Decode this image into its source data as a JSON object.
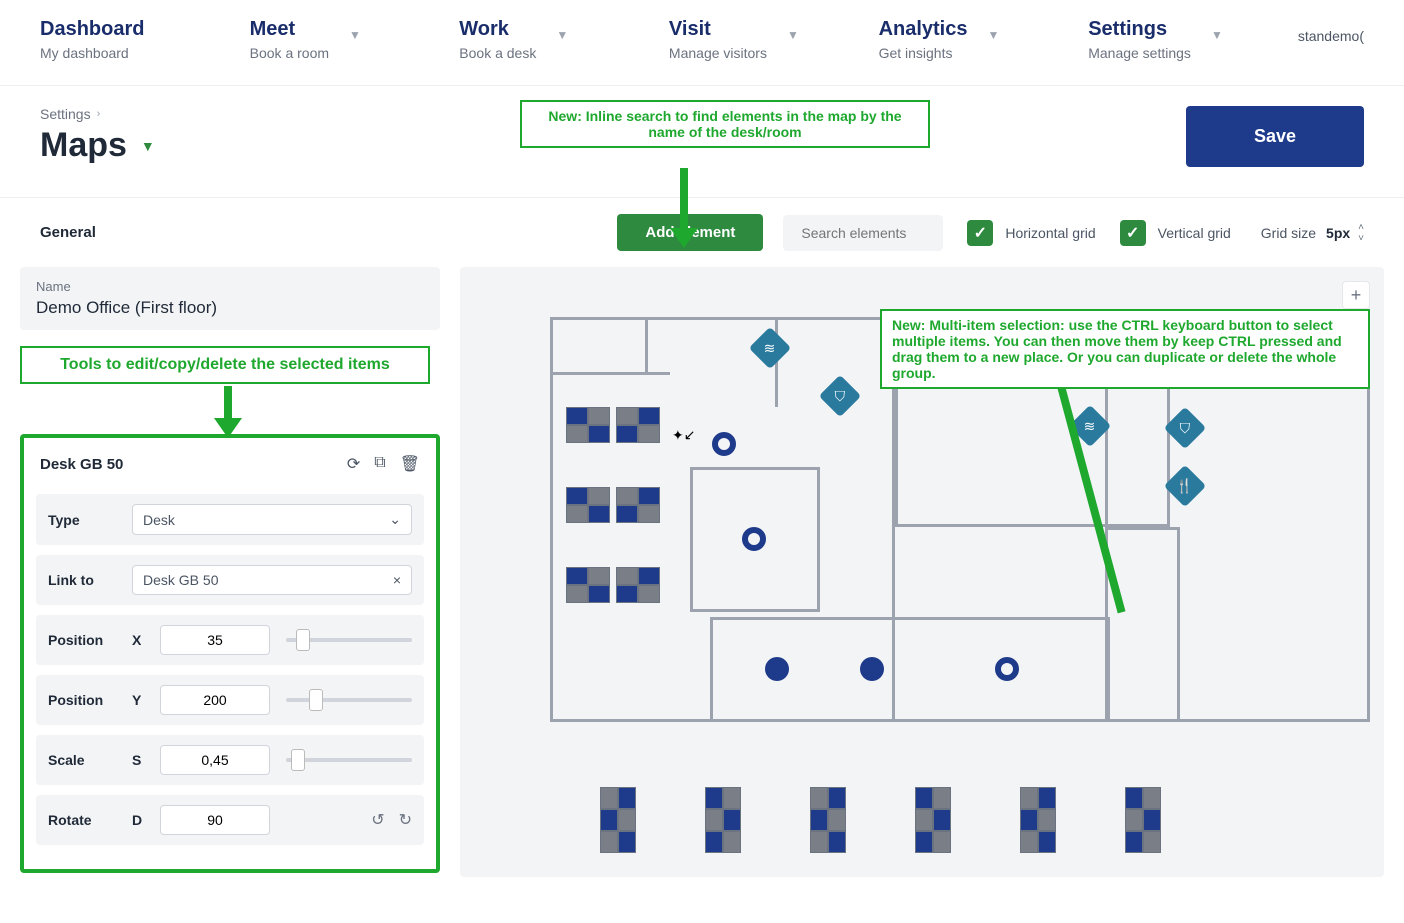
{
  "nav": {
    "items": [
      {
        "title": "Dashboard",
        "sub": "My dashboard",
        "chev": false
      },
      {
        "title": "Meet",
        "sub": "Book a room",
        "chev": true
      },
      {
        "title": "Work",
        "sub": "Book a desk",
        "chev": true
      },
      {
        "title": "Visit",
        "sub": "Manage visitors",
        "chev": true
      },
      {
        "title": "Analytics",
        "sub": "Get insights",
        "chev": true
      },
      {
        "title": "Settings",
        "sub": "Manage settings",
        "chev": true
      }
    ],
    "user": "standemo("
  },
  "breadcrumb": {
    "parent": "Settings"
  },
  "page": {
    "title": "Maps",
    "save_label": "Save"
  },
  "callouts": {
    "search": "New: Inline search to find elements in the map by the name of the desk/room",
    "tools": "Tools to edit/copy/delete the selected items",
    "multi": "New: Multi-item selection: use the CTRL keyboard button to select multiple items. You can then move them by keep CTRL pressed and drag them to a new place. Or you can duplicate or delete the whole group."
  },
  "toolbar": {
    "tab": "General",
    "add_label": "Add element",
    "search_placeholder": "Search elements",
    "hgrid_label": "Horizontal grid",
    "vgrid_label": "Vertical grid",
    "gridsize_label": "Grid size",
    "gridsize_value": "5px"
  },
  "map_name": {
    "label": "Name",
    "value": "Demo Office (First floor)"
  },
  "panel": {
    "title": "Desk GB 50",
    "type_label": "Type",
    "type_value": "Desk",
    "link_label": "Link to",
    "link_value": "Desk GB 50",
    "posx_label": "Position",
    "posx_axis": "X",
    "posx_value": "35",
    "posy_label": "Position",
    "posy_axis": "Y",
    "posy_value": "200",
    "scale_label": "Scale",
    "scale_axis": "S",
    "scale_value": "0,45",
    "rotate_label": "Rotate",
    "rotate_axis": "D",
    "rotate_value": "90"
  }
}
